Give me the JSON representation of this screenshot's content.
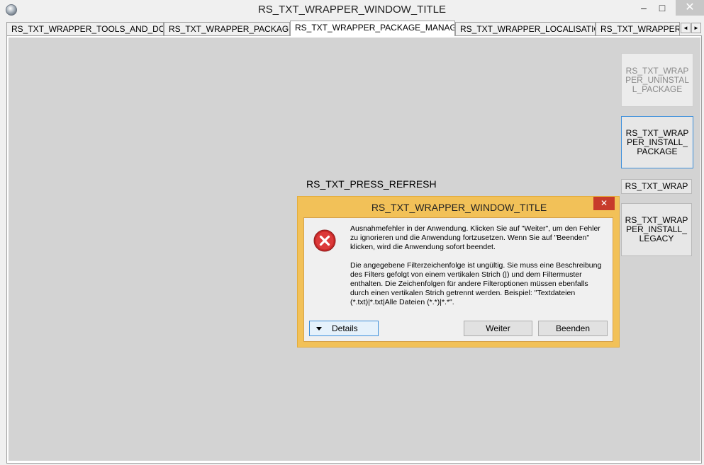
{
  "window": {
    "title": "RS_TXT_WRAPPER_WINDOW_TITLE",
    "controls": {
      "minimize": "–",
      "maximize": "□",
      "close": "✕"
    }
  },
  "tabs": [
    {
      "label": "RS_TXT_WRAPPER_TOOLS_AND_DOCS",
      "active": false
    },
    {
      "label": "RS_TXT_WRAPPER_PACKAGER",
      "active": false
    },
    {
      "label": "RS_TXT_WRAPPER_PACKAGE_MANAGER",
      "active": true
    },
    {
      "label": "RS_TXT_WRAPPER_LOCALISATION",
      "active": false
    },
    {
      "label": "RS_TXT_WRAPPER_S",
      "active": false
    }
  ],
  "tab_scroll": {
    "left": "◄",
    "right": "►"
  },
  "side_buttons": {
    "uninstall": "RS_TXT_WRAPPER_UNINSTALL_PACKAGE",
    "install": "RS_TXT_WRAPPER_INSTALL_PACKAGE",
    "small": "RS_TXT_WRAP",
    "install_legacy": "RS_TXT_WRAPPER_INSTALL_LEGACY"
  },
  "status": {
    "refresh_label": "RS_TXT_PRESS_REFRESH"
  },
  "dialog": {
    "title": "RS_TXT_WRAPPER_WINDOW_TITLE",
    "close": "✕",
    "message_main": "Ausnahmefehler in der Anwendung. Klicken Sie auf \"Weiter\", um den Fehler zu ignorieren und die Anwendung fortzusetzen. Wenn Sie auf \"Beenden\" klicken, wird die Anwendung sofort beendet.",
    "message_detail": "Die angegebene Filterzeichenfolge ist ungültig. Sie muss eine Beschreibung des Filters gefolgt von einem vertikalen Strich (|) und dem Filtermuster enthalten. Die Zeichenfolgen für andere Filteroptionen müssen ebenfalls durch einen vertikalen Strich getrennt werden. Beispiel: \"Textdateien (*.txt)|*.txt|Alle Dateien (*.*)|*.*\".",
    "details_label": "Details",
    "continue_label": "Weiter",
    "quit_label": "Beenden",
    "icon": "error-icon",
    "colors": {
      "frame": "#f2c158",
      "close": "#c73b2b",
      "error": "#c62828"
    }
  }
}
